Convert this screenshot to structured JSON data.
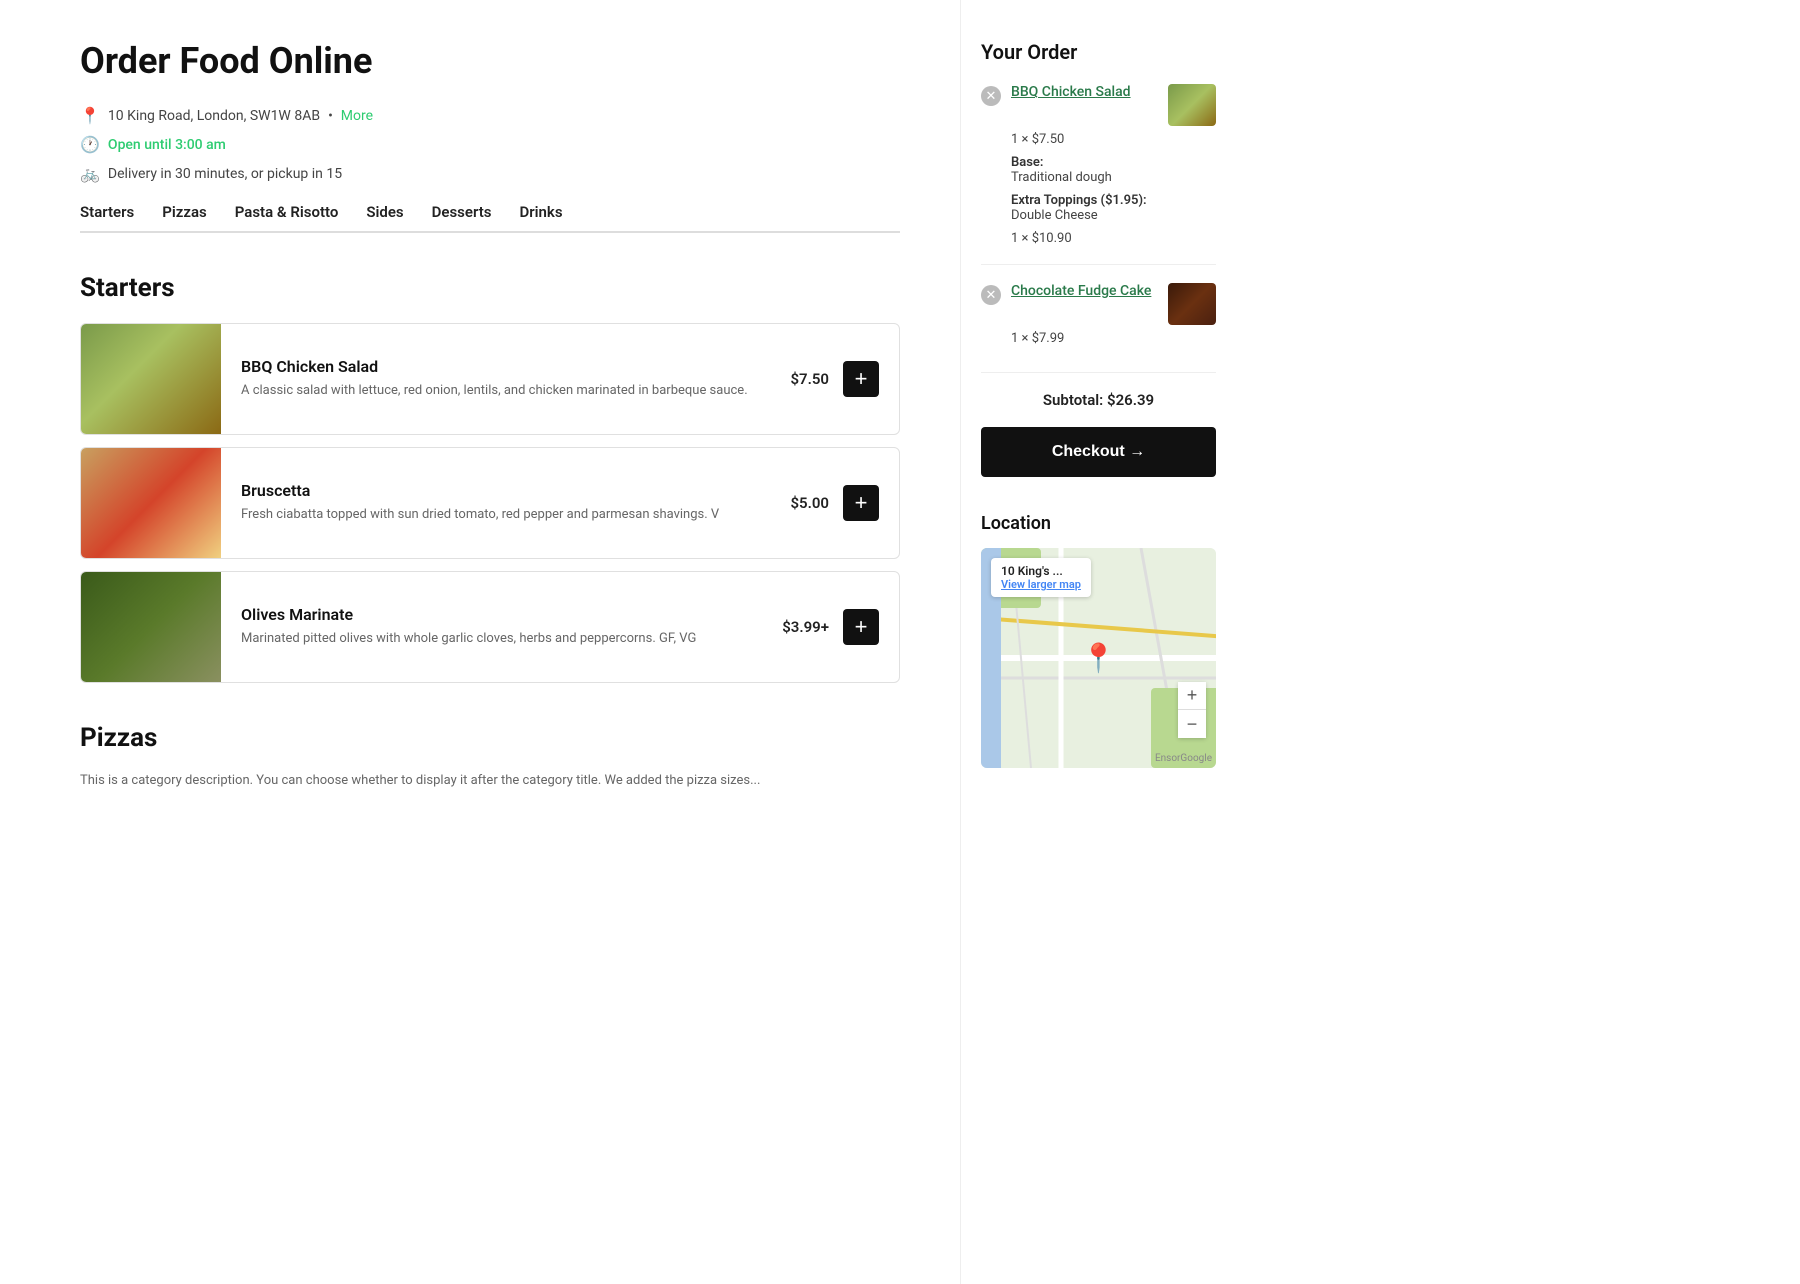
{
  "page": {
    "title": "Order Food Online"
  },
  "restaurant": {
    "address": "10 King Road, London, SW1W 8AB",
    "address_short": "10 King's ...",
    "more_label": "More",
    "open_status": "Open until 3:00 am",
    "delivery_info": "Delivery in 30 minutes, or pickup in 15"
  },
  "nav": {
    "tabs": [
      {
        "label": "Starters",
        "id": "starters"
      },
      {
        "label": "Pizzas",
        "id": "pizzas"
      },
      {
        "label": "Pasta & Risotto",
        "id": "pasta"
      },
      {
        "label": "Sides",
        "id": "sides"
      },
      {
        "label": "Desserts",
        "id": "desserts"
      },
      {
        "label": "Drinks",
        "id": "drinks"
      }
    ]
  },
  "sections": [
    {
      "id": "starters",
      "title": "Starters",
      "items": [
        {
          "name": "BBQ Chicken Salad",
          "description": "A classic salad with lettuce, red onion, lentils, and chicken marinated in barbeque sauce.",
          "price": "$7.50",
          "img_class": "img-bbq"
        },
        {
          "name": "Bruscetta",
          "description": "Fresh ciabatta topped with sun dried tomato, red pepper and parmesan shavings. V",
          "price": "$5.00",
          "img_class": "img-bruscetta"
        },
        {
          "name": "Olives Marinate",
          "description": "Marinated pitted olives with whole garlic cloves, herbs and peppercorns. GF, VG",
          "price": "$3.99+",
          "img_class": "img-olives"
        }
      ]
    },
    {
      "id": "pizzas",
      "title": "Pizzas",
      "description": "This is a category description. You can choose whether to display it after the category title. We added the pizza sizes..."
    }
  ],
  "order": {
    "title": "Your Order",
    "items": [
      {
        "name": "BBQ Chicken Salad",
        "qty_price": "1 × $7.50",
        "base_label": "Base:",
        "base_value": "Traditional dough",
        "extra_label": "Extra Toppings ($1.95):",
        "extra_value": "Double Cheese",
        "item_total": "1 × $10.90",
        "thumb_class": "thumb-bbq"
      },
      {
        "name": "Chocolate Fudge Cake",
        "qty_price": "1 × $7.99",
        "base_label": "",
        "base_value": "",
        "extra_label": "",
        "extra_value": "",
        "item_total": "",
        "thumb_class": "thumb-choc"
      }
    ],
    "subtotal_label": "Subtotal:",
    "subtotal_value": "$26.39",
    "checkout_label": "Checkout →"
  },
  "location": {
    "title": "Location",
    "map_label": "10 King's ...",
    "map_link": "View larger map",
    "zoom_in": "+",
    "zoom_out": "−",
    "google_label": "EnsorGoogle"
  }
}
